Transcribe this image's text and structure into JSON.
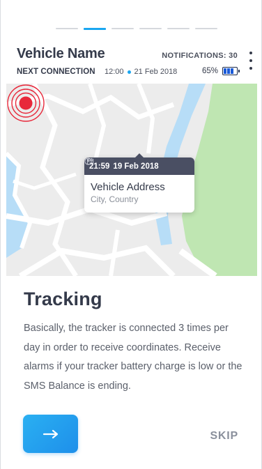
{
  "pager": {
    "total": 6,
    "active_index": 1
  },
  "header": {
    "vehicle_name": "Vehicle Name",
    "notifications_label": "NOTIFICATIONS: 30",
    "next_connection_label": "NEXT CONNECTION",
    "next_connection_time": "12:00",
    "next_connection_date": "21 Feb 2018",
    "battery_percent": "65%",
    "battery_level": 0.65
  },
  "map": {
    "popup": {
      "time": "21:59",
      "date": "19 Feb 2018",
      "address": "Vehicle Address",
      "location": "City, Country"
    }
  },
  "content": {
    "title": "Tracking",
    "description": "Basically, the tracker is connected 3 times per day in order to receive coordinates. Receive alarms if your tracker battery charge is low or the SMS Balance is ending."
  },
  "actions": {
    "next_icon": "arrow-right-icon",
    "skip_label": "SKIP"
  },
  "colors": {
    "accent": "#1aa6f0",
    "pin": "#e8283a",
    "park": "#bfe6b2",
    "water": "#b7ddf7",
    "popup_header": "#4a4f63"
  }
}
